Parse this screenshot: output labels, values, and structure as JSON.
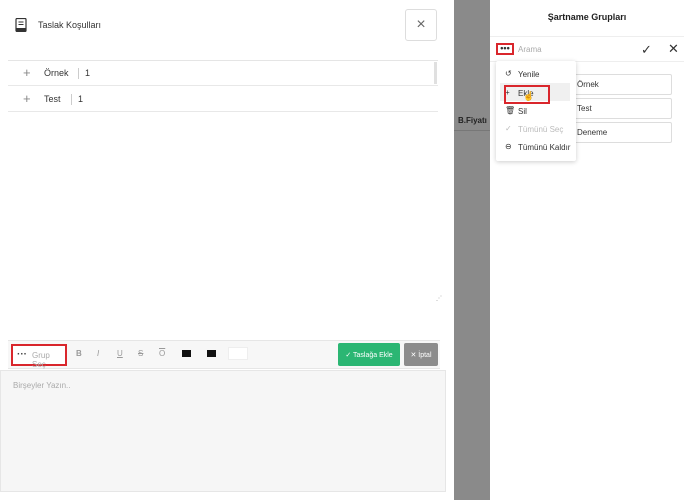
{
  "modal": {
    "title": "Taslak Koşulları",
    "close_label": "×",
    "rows": [
      {
        "name": "Örnek",
        "count": "1"
      },
      {
        "name": "Test",
        "count": "1"
      }
    ]
  },
  "toolbar": {
    "group_dots": "···",
    "group_label": "Grup Seç",
    "bold": "B",
    "italic": "I",
    "underline": "U",
    "strike": "S",
    "overline": "O",
    "add_label": "✓ Taslağa Ekle",
    "cancel_label": "✕ İptal"
  },
  "editor": {
    "placeholder": "Birşeyler Yazın.."
  },
  "backdrop": {
    "column_header": "B.Fiyatı"
  },
  "right_panel": {
    "title": "Şartname Grupları",
    "search_dots": "•••",
    "search_placeholder": "Arama",
    "check": "✓",
    "close": "✕",
    "items": [
      "Örnek",
      "Test",
      "Deneme"
    ]
  },
  "menu": {
    "items": [
      {
        "icon": "↺",
        "label": "Yenile"
      },
      {
        "icon": "+",
        "label": "Ekle"
      },
      {
        "icon": "🗑",
        "label": "Sil"
      },
      {
        "icon": "✓",
        "label": "Tümünü Seç"
      },
      {
        "icon": "⊖",
        "label": "Tümünü Kaldır"
      }
    ]
  },
  "colors": {
    "accent_green": "#2bb673",
    "highlight_red": "#d9262c",
    "cancel_gray": "#8c8c8c"
  }
}
